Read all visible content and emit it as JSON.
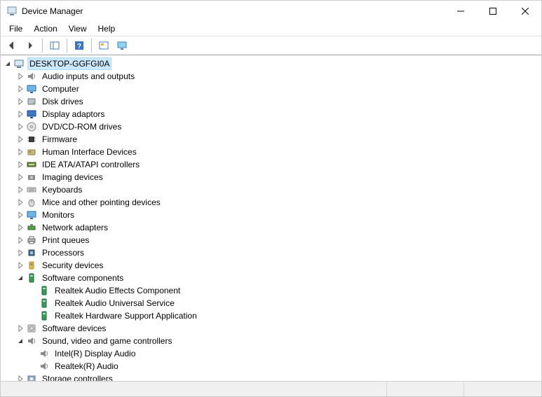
{
  "window": {
    "title": "Device Manager"
  },
  "menu": {
    "file": "File",
    "action": "Action",
    "view": "View",
    "help": "Help"
  },
  "tree": {
    "root": {
      "label": "DESKTOP-GGFGI0A",
      "expanded": true,
      "icon": "computer"
    },
    "categories": [
      {
        "label": "Audio inputs and outputs",
        "icon": "speaker",
        "expanded": false
      },
      {
        "label": "Computer",
        "icon": "monitor",
        "expanded": false
      },
      {
        "label": "Disk drives",
        "icon": "disk",
        "expanded": false
      },
      {
        "label": "Display adaptors",
        "icon": "display",
        "expanded": false
      },
      {
        "label": "DVD/CD-ROM drives",
        "icon": "cd",
        "expanded": false
      },
      {
        "label": "Firmware",
        "icon": "chip",
        "expanded": false
      },
      {
        "label": "Human Interface Devices",
        "icon": "hid",
        "expanded": false
      },
      {
        "label": "IDE ATA/ATAPI controllers",
        "icon": "ide",
        "expanded": false
      },
      {
        "label": "Imaging devices",
        "icon": "camera",
        "expanded": false
      },
      {
        "label": "Keyboards",
        "icon": "keyboard",
        "expanded": false
      },
      {
        "label": "Mice and other pointing devices",
        "icon": "mouse",
        "expanded": false
      },
      {
        "label": "Monitors",
        "icon": "monitor",
        "expanded": false
      },
      {
        "label": "Network adapters",
        "icon": "network",
        "expanded": false
      },
      {
        "label": "Print queues",
        "icon": "printer",
        "expanded": false
      },
      {
        "label": "Processors",
        "icon": "cpu",
        "expanded": false
      },
      {
        "label": "Security devices",
        "icon": "security",
        "expanded": false
      },
      {
        "label": "Software components",
        "icon": "component",
        "expanded": true,
        "children": [
          {
            "label": "Realtek Audio Effects Component",
            "icon": "component"
          },
          {
            "label": "Realtek Audio Universal Service",
            "icon": "component"
          },
          {
            "label": "Realtek Hardware Support Application",
            "icon": "component"
          }
        ]
      },
      {
        "label": "Software devices",
        "icon": "softdev",
        "expanded": false
      },
      {
        "label": "Sound, video and game controllers",
        "icon": "speaker",
        "expanded": true,
        "children": [
          {
            "label": "Intel(R) Display Audio",
            "icon": "speaker"
          },
          {
            "label": "Realtek(R) Audio",
            "icon": "speaker"
          }
        ]
      },
      {
        "label": "Storage controllers",
        "icon": "storage",
        "expanded": false
      }
    ]
  }
}
